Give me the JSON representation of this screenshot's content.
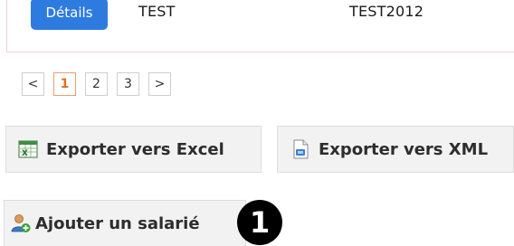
{
  "table": {
    "row": {
      "details_label": "Détails",
      "cells": [
        "TEST",
        "TEST2012"
      ]
    }
  },
  "pagination": {
    "prev_label": "<",
    "pages": [
      "1",
      "2",
      "3"
    ],
    "active_page": "1",
    "next_label": ">"
  },
  "export": {
    "excel_label": "Exporter vers Excel",
    "xml_label": "Exporter vers XML"
  },
  "actions": {
    "add_employee_label": "Ajouter un salarié",
    "step_marker": "1"
  },
  "colors": {
    "details_button": "#2e7be0",
    "active_page": "#e07020",
    "button_bg": "#f2f2f2"
  }
}
